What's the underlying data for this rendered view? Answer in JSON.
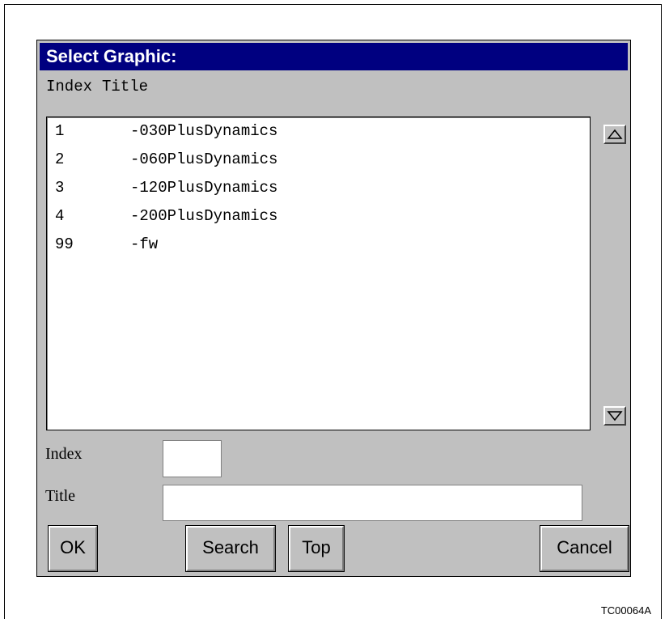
{
  "dialog": {
    "title": "Select Graphic:",
    "column_headers": {
      "index": "Index",
      "title": "Title"
    },
    "list": {
      "items": [
        {
          "index": "1",
          "title": "-030PlusDynamics"
        },
        {
          "index": "2",
          "title": "-060PlusDynamics"
        },
        {
          "index": "3",
          "title": "-120PlusDynamics"
        },
        {
          "index": "4",
          "title": "-200PlusDynamics"
        },
        {
          "index": "99",
          "title": "-fw"
        }
      ]
    },
    "fields": {
      "index_label": "Index",
      "index_value": "",
      "title_label": "Title",
      "title_value": ""
    },
    "buttons": {
      "ok": "OK",
      "search": "Search",
      "top": "Top",
      "cancel": "Cancel"
    },
    "icons": {
      "scroll_up": "triangle-up-icon",
      "scroll_down": "triangle-down-icon"
    },
    "colors": {
      "titlebar": "#000080",
      "dialog_bg": "#c0c0c0"
    }
  },
  "figure_id": "TC00064A"
}
